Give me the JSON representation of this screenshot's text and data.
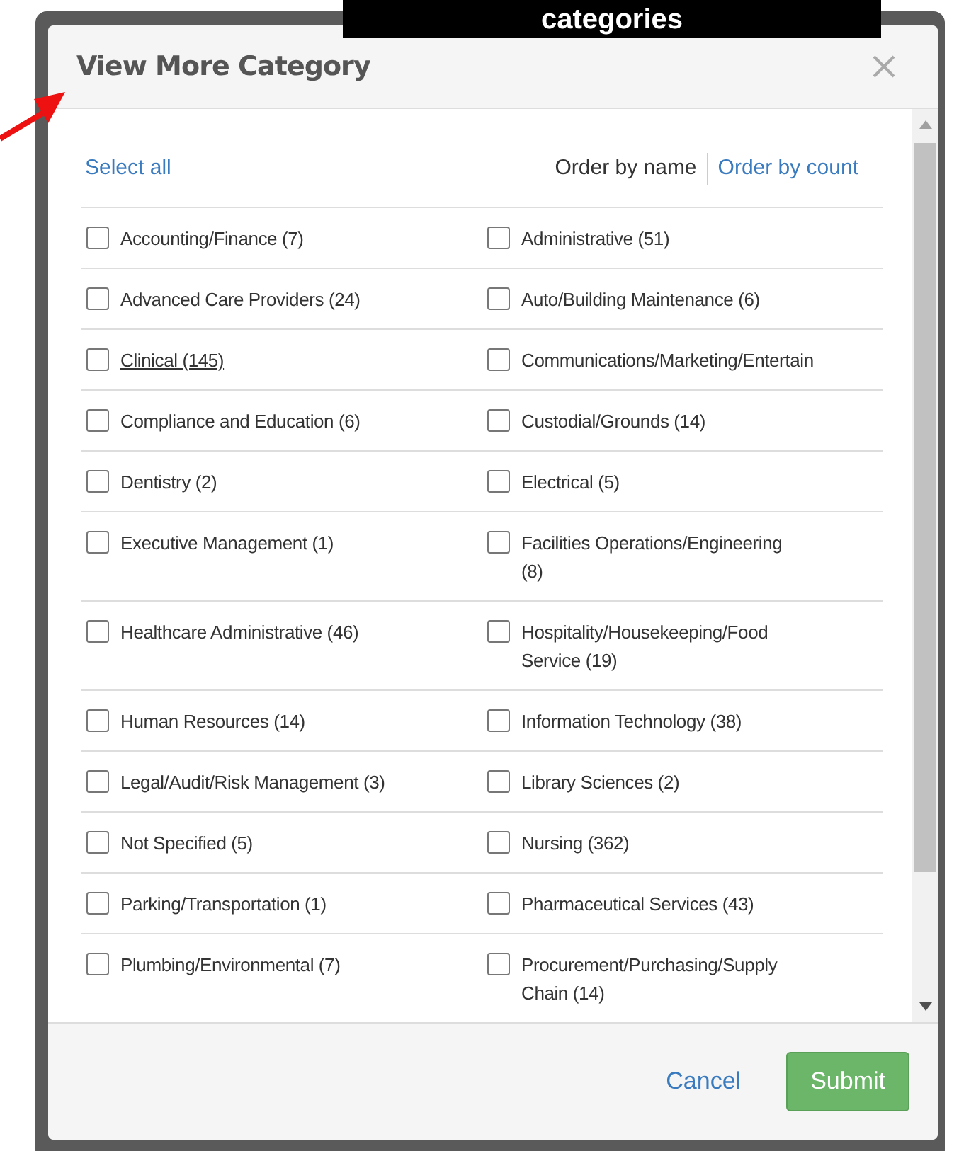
{
  "banner": {
    "text": "categories"
  },
  "dialog": {
    "title": "View More Category",
    "select_all": "Select all",
    "sort_options": [
      {
        "label": "Order by name",
        "selected": true
      },
      {
        "label": "Order by count",
        "selected": false
      }
    ],
    "categories": [
      {
        "label": "Accounting/Finance (7)",
        "checked": false,
        "hovered": false
      },
      {
        "label": "Administrative (51)",
        "checked": false,
        "hovered": false
      },
      {
        "label": "Advanced Care Providers (24)",
        "checked": false,
        "hovered": false
      },
      {
        "label": "Auto/Building Maintenance (6)",
        "checked": false,
        "hovered": false
      },
      {
        "label": "Clinical (145)",
        "checked": false,
        "hovered": true
      },
      {
        "label": "Communications/Marketing/Entertain",
        "checked": false,
        "hovered": false
      },
      {
        "label": "Compliance and Education (6)",
        "checked": false,
        "hovered": false
      },
      {
        "label": "Custodial/Grounds (14)",
        "checked": false,
        "hovered": false
      },
      {
        "label": "Dentistry (2)",
        "checked": false,
        "hovered": false
      },
      {
        "label": "Electrical (5)",
        "checked": false,
        "hovered": false
      },
      {
        "label": "Executive Management (1)",
        "checked": false,
        "hovered": false
      },
      {
        "label": "Facilities Operations/Engineering (8)",
        "checked": false,
        "hovered": false
      },
      {
        "label": "Healthcare Administrative (46)",
        "checked": false,
        "hovered": false
      },
      {
        "label": "Hospitality/Housekeeping/Food Service (19)",
        "checked": false,
        "hovered": false
      },
      {
        "label": "Human Resources (14)",
        "checked": false,
        "hovered": false
      },
      {
        "label": "Information Technology (38)",
        "checked": false,
        "hovered": false
      },
      {
        "label": "Legal/Audit/Risk Management (3)",
        "checked": false,
        "hovered": false
      },
      {
        "label": "Library Sciences (2)",
        "checked": false,
        "hovered": false
      },
      {
        "label": "Not Specified (5)",
        "checked": false,
        "hovered": false
      },
      {
        "label": "Nursing (362)",
        "checked": false,
        "hovered": false
      },
      {
        "label": "Parking/Transportation (1)",
        "checked": false,
        "hovered": false
      },
      {
        "label": "Pharmaceutical Services (43)",
        "checked": false,
        "hovered": false
      },
      {
        "label": "Plumbing/Environmental (7)",
        "checked": false,
        "hovered": false
      },
      {
        "label": "Procurement/Purchasing/Supply Chain (14)",
        "checked": false,
        "hovered": false
      }
    ],
    "buttons": {
      "cancel": "Cancel",
      "submit": "Submit"
    }
  }
}
